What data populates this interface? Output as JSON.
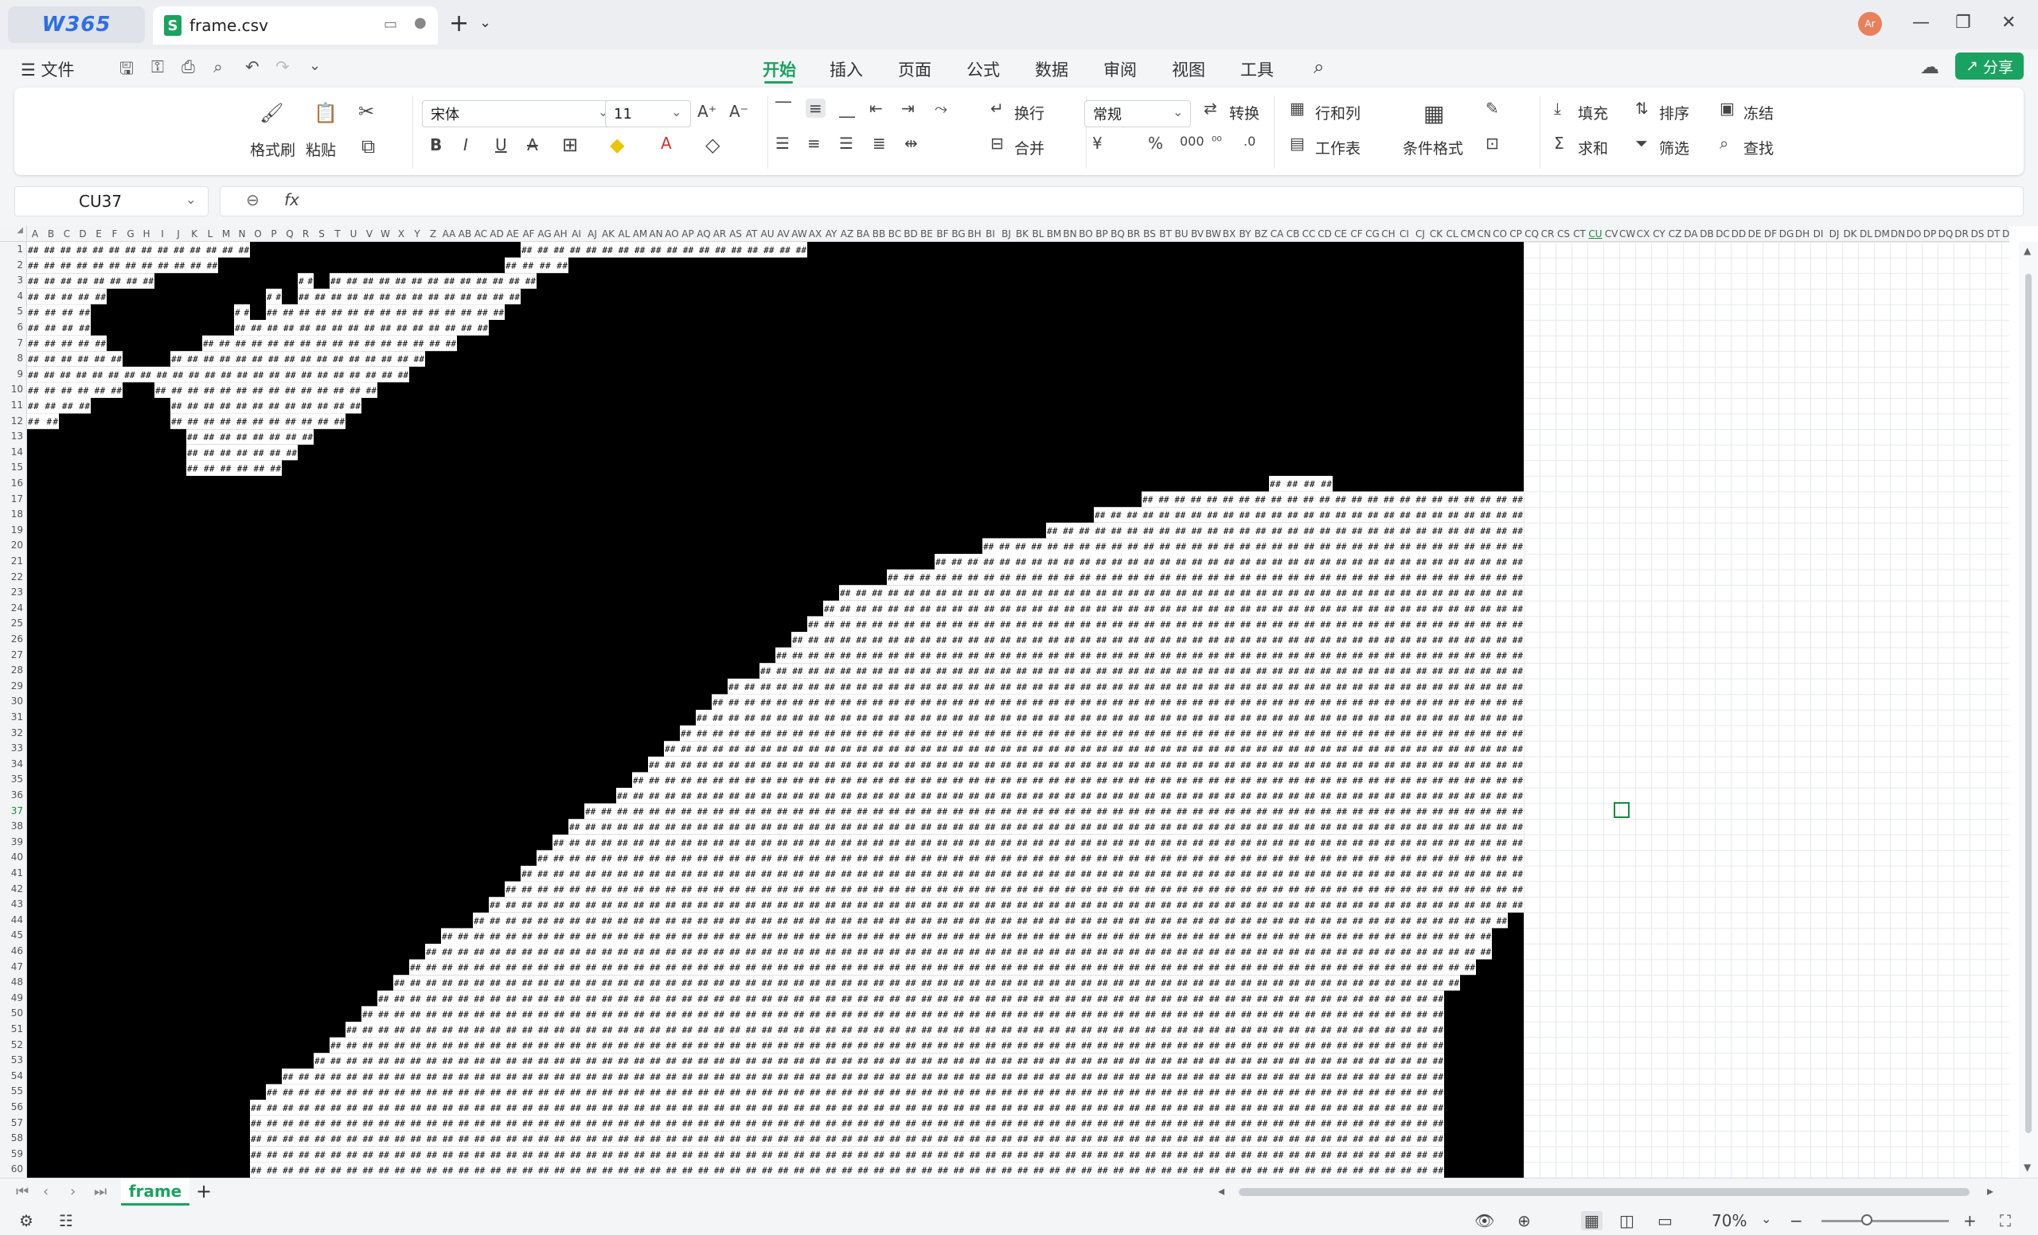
{
  "titlebar": {
    "home_tab": "W365",
    "file_tab": "frame.csv",
    "file_icon": "S",
    "avatar": "Ar"
  },
  "menubar": {
    "file_menu": "☰ 文件",
    "tabs": [
      "开始",
      "插入",
      "页面",
      "公式",
      "数据",
      "审阅",
      "视图",
      "工具"
    ],
    "active_tab": "开始",
    "share": "分享"
  },
  "ribbon": {
    "format_painter": "格式刷",
    "paste": "粘贴",
    "font_name": "宋体",
    "font_size": "11",
    "wrap": "换行",
    "merge": "合并",
    "number_format": "常规",
    "convert": "转换",
    "rows_cols": "行和列",
    "worksheet": "工作表",
    "cond_format": "条件格式",
    "fill": "填充",
    "sort": "排序",
    "freeze": "冻结",
    "sum": "求和",
    "filter": "筛选",
    "find": "查找"
  },
  "formulabar": {
    "cell_ref": "CU37",
    "fx": "fx",
    "value": ""
  },
  "grid": {
    "columns": [
      "A",
      "B",
      "C",
      "D",
      "E",
      "F",
      "G",
      "H",
      "I",
      "J",
      "K",
      "L",
      "M",
      "N",
      "O",
      "P",
      "Q",
      "R",
      "S",
      "T",
      "U",
      "V",
      "W",
      "X",
      "Y",
      "Z",
      "AA",
      "AB",
      "AC",
      "AD",
      "AE",
      "AF",
      "AG",
      "AH",
      "AI",
      "AJ",
      "AK",
      "AL",
      "AM",
      "AN",
      "AO",
      "AP",
      "AQ",
      "AR",
      "AS",
      "AT",
      "AU",
      "AV",
      "AW",
      "AX",
      "AY",
      "AZ",
      "BA",
      "BB",
      "BC",
      "BD",
      "BE",
      "BF",
      "BG",
      "BH",
      "BI",
      "BJ",
      "BK",
      "BL",
      "BM",
      "BN",
      "BO",
      "BP",
      "BQ",
      "BR",
      "BS",
      "BT",
      "BU",
      "BV",
      "BW",
      "BX",
      "BY",
      "BZ",
      "CA",
      "CB",
      "CC",
      "CD",
      "CE",
      "CF",
      "CG",
      "CH",
      "CI",
      "CJ",
      "CK",
      "CL",
      "CM",
      "CN",
      "CO",
      "CP",
      "CQ",
      "CR",
      "CS",
      "CT",
      "CU",
      "CV",
      "CW",
      "CX",
      "CY",
      "CZ",
      "DA",
      "DB",
      "DC",
      "DD",
      "DE",
      "DF",
      "DG",
      "DH",
      "DI",
      "DJ",
      "DK",
      "DL",
      "DM",
      "DN",
      "DO",
      "DP",
      "DQ",
      "DR",
      "DS",
      "DT",
      "DU"
    ],
    "row_count": 62,
    "fill_text": "##",
    "selected_cell": "CU37"
  },
  "sheetbar": {
    "sheet_name": "frame",
    "add": "+"
  },
  "statusbar": {
    "zoom": "70%"
  },
  "colors": {
    "accent": "#1aa260",
    "cell_dark": "#000000",
    "cell_text": "#000000"
  }
}
